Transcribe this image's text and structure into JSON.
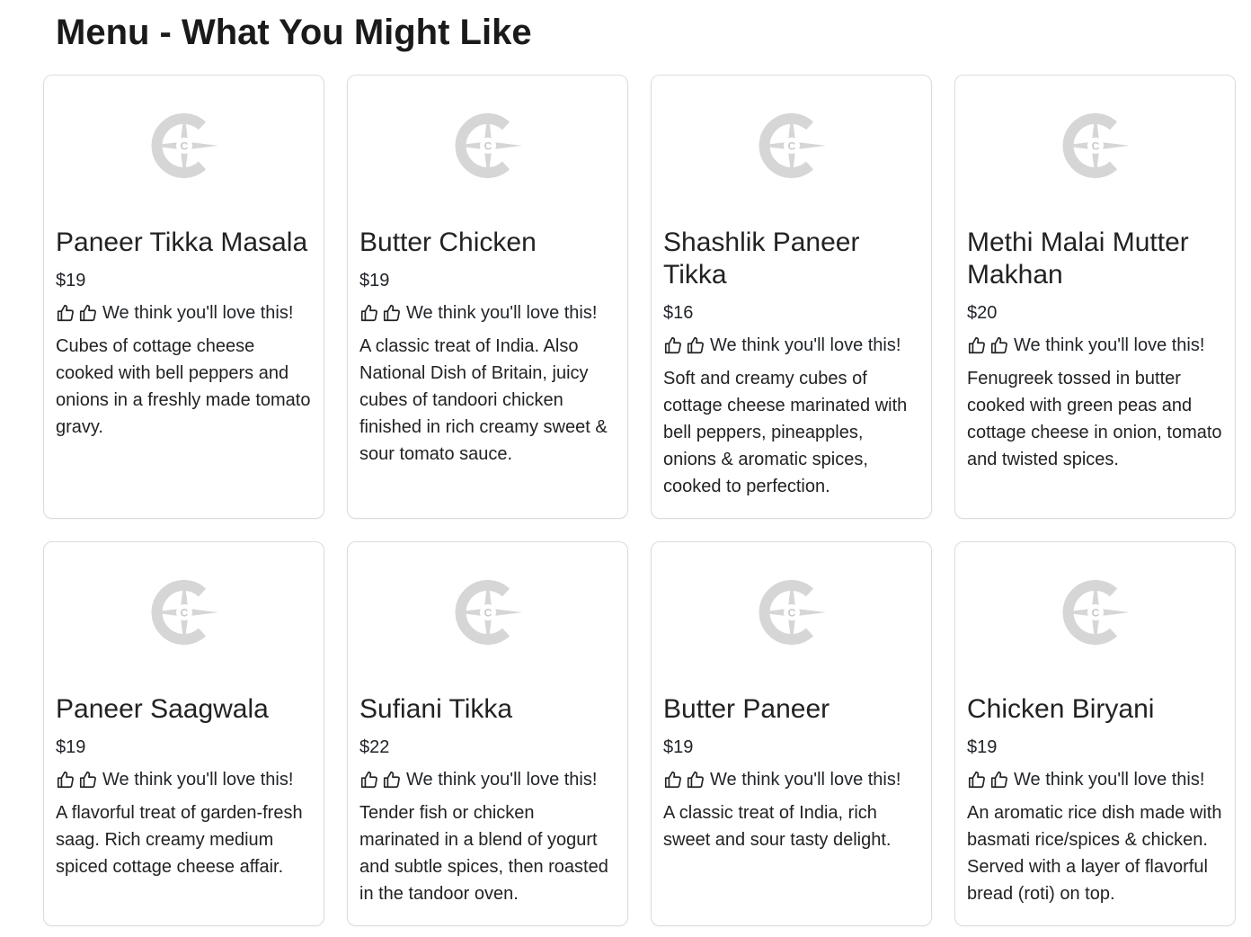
{
  "page": {
    "title": "Menu - What You Might Like"
  },
  "icons": {
    "placeholder": "compass-c-logo-icon",
    "thumb": "thumbs-up-icon",
    "placeholder_color": "#d6d6d6"
  },
  "items": [
    {
      "name": "Paneer Tikka Masala",
      "price": "$19",
      "rec": "We think you'll love this!",
      "desc": "Cubes of cottage cheese cooked with bell peppers and onions in a freshly made tomato gravy."
    },
    {
      "name": "Butter Chicken",
      "price": "$19",
      "rec": "We think you'll love this!",
      "desc": "A classic treat of India. Also National Dish of Britain, juicy cubes of tandoori chicken finished in rich creamy sweet & sour tomato sauce."
    },
    {
      "name": "Shashlik Paneer Tikka",
      "price": "$16",
      "rec": "We think you'll love this!",
      "desc": "Soft and creamy cubes of cottage cheese marinated with bell peppers, pineapples, onions & aromatic spices, cooked to perfection."
    },
    {
      "name": "Methi Malai Mutter Makhan",
      "price": "$20",
      "rec": "We think you'll love this!",
      "desc": "Fenugreek tossed in butter cooked with green peas and cottage cheese in onion, tomato and twisted spices."
    },
    {
      "name": "Paneer Saagwala",
      "price": "$19",
      "rec": "We think you'll love this!",
      "desc": "A flavorful treat of garden-fresh saag. Rich creamy medium spiced cottage cheese affair."
    },
    {
      "name": "Sufiani Tikka",
      "price": "$22",
      "rec": "We think you'll love this!",
      "desc": "Tender fish or chicken marinated in a blend of yogurt and subtle spices, then roasted in the tandoor oven."
    },
    {
      "name": "Butter Paneer",
      "price": "$19",
      "rec": "We think you'll love this!",
      "desc": "A classic treat of India, rich sweet and sour tasty delight."
    },
    {
      "name": "Chicken Biryani",
      "price": "$19",
      "rec": "We think you'll love this!",
      "desc": "An aromatic rice dish made with basmati rice/spices & chicken. Served with a layer of flavorful bread (roti) on top."
    }
  ]
}
